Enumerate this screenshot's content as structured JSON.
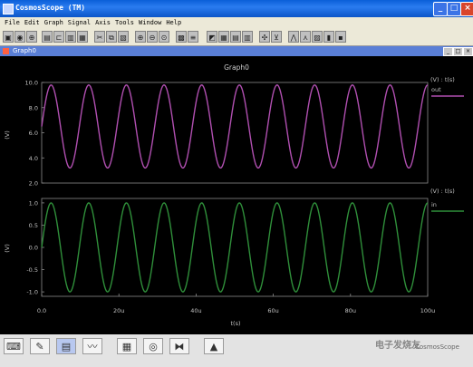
{
  "window": {
    "title": "CosmosScope (TM)",
    "min": "_",
    "max": "□",
    "close": "×"
  },
  "menu": [
    "File",
    "Edit",
    "Graph",
    "Signal",
    "Axis",
    "Tools",
    "Window",
    "Help"
  ],
  "subwindow": {
    "title": "Graph0"
  },
  "graph": {
    "title": "Graph0",
    "xlabel": "t(s)",
    "xticks": [
      "0.0",
      "20u",
      "40u",
      "60u",
      "80u",
      "100u"
    ]
  },
  "chart_data": [
    {
      "type": "line",
      "title": "Graph0",
      "ylabel": "(V)",
      "header": "(V) : t(s)",
      "yticks": [
        "10.0",
        "8.0",
        "6.0",
        "4.0",
        "2.0"
      ],
      "ylim": [
        2.0,
        10.0
      ],
      "xlim": [
        0,
        100
      ],
      "series": [
        {
          "name": "out",
          "color": "#b04fb0",
          "offset": 6.5,
          "amplitude": 3.3,
          "cycles": 10.25
        }
      ]
    },
    {
      "type": "line",
      "ylabel": "(V)",
      "header": "(V) : t(s)",
      "yticks": [
        "1.0",
        "0.5",
        "0.0",
        "-0.5",
        "-1.0"
      ],
      "ylim": [
        -1.1,
        1.1
      ],
      "xlim": [
        0,
        100
      ],
      "series": [
        {
          "name": "in",
          "color": "#2f8f3a",
          "offset": 0,
          "amplitude": 1.0,
          "cycles": 10.25
        }
      ]
    }
  ],
  "watermark": {
    "main": "电子发烧友",
    "sub": "CosmosScope"
  }
}
